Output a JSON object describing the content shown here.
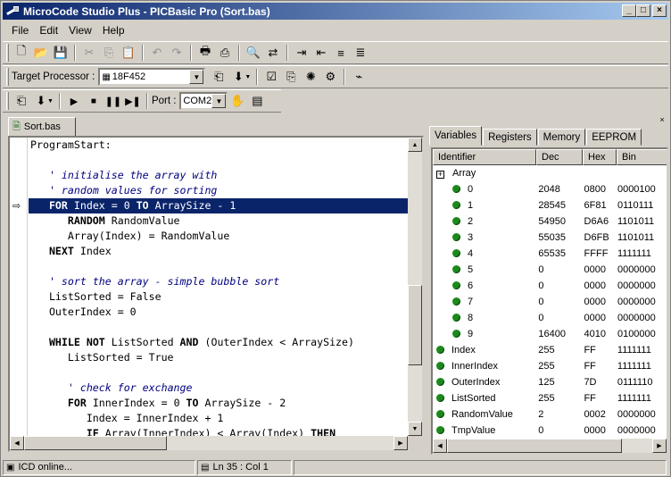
{
  "window": {
    "title": "MicroCode Studio Plus - PICBasic Pro (Sort.bas)"
  },
  "menu": {
    "items": [
      "File",
      "Edit",
      "View",
      "Help"
    ]
  },
  "toolbar2": {
    "target_label": "Target Processor :",
    "processor": "18F452"
  },
  "toolbar3": {
    "port_label": "Port :",
    "port": "COM2"
  },
  "editor": {
    "tab_label": "Sort.bas",
    "lines": [
      {
        "parts": [
          [
            "t",
            "ProgramStart:"
          ]
        ]
      },
      {
        "parts": []
      },
      {
        "parts": [
          [
            "t",
            "   "
          ],
          [
            "c",
            "' initialise the array with"
          ]
        ]
      },
      {
        "parts": [
          [
            "t",
            "   "
          ],
          [
            "c",
            "' random values for sorting"
          ]
        ]
      },
      {
        "hl": true,
        "parts": [
          [
            "t",
            "   "
          ],
          [
            "k",
            "FOR"
          ],
          [
            "t",
            " Index = 0 "
          ],
          [
            "k",
            "TO"
          ],
          [
            "t",
            " ArraySize - 1"
          ]
        ]
      },
      {
        "parts": [
          [
            "t",
            "      "
          ],
          [
            "k",
            "RANDOM"
          ],
          [
            "t",
            " RandomValue"
          ]
        ]
      },
      {
        "parts": [
          [
            "t",
            "      Array(Index) = RandomValue"
          ]
        ]
      },
      {
        "parts": [
          [
            "t",
            "   "
          ],
          [
            "k",
            "NEXT"
          ],
          [
            "t",
            " Index"
          ]
        ]
      },
      {
        "parts": []
      },
      {
        "parts": [
          [
            "t",
            "   "
          ],
          [
            "c",
            "' sort the array - simple bubble sort"
          ]
        ]
      },
      {
        "parts": [
          [
            "t",
            "   ListSorted = False"
          ]
        ]
      },
      {
        "parts": [
          [
            "t",
            "   OuterIndex = 0"
          ]
        ]
      },
      {
        "parts": []
      },
      {
        "parts": [
          [
            "t",
            "   "
          ],
          [
            "k",
            "WHILE NOT"
          ],
          [
            "t",
            " ListSorted "
          ],
          [
            "k",
            "AND"
          ],
          [
            "t",
            " (OuterIndex < ArraySize)"
          ]
        ]
      },
      {
        "parts": [
          [
            "t",
            "      ListSorted = True"
          ]
        ]
      },
      {
        "parts": []
      },
      {
        "parts": [
          [
            "t",
            "      "
          ],
          [
            "c",
            "' check for exchange"
          ]
        ]
      },
      {
        "parts": [
          [
            "t",
            "      "
          ],
          [
            "k",
            "FOR"
          ],
          [
            "t",
            " InnerIndex = 0 "
          ],
          [
            "k",
            "TO"
          ],
          [
            "t",
            " ArraySize - 2"
          ]
        ]
      },
      {
        "parts": [
          [
            "t",
            "         Index = InnerIndex + 1"
          ]
        ]
      },
      {
        "parts": [
          [
            "t",
            "         "
          ],
          [
            "k",
            "IF"
          ],
          [
            "t",
            " Array(InnerIndex) < Array(Index) "
          ],
          [
            "k",
            "THEN"
          ]
        ]
      }
    ]
  },
  "panel": {
    "tabs": [
      "Variables",
      "Registers",
      "Memory",
      "EEPROM"
    ],
    "active_tab": 0,
    "columns": [
      "Identifier",
      "Dec",
      "Hex",
      "Bin"
    ],
    "rows": [
      {
        "kind": "group",
        "name": "Array",
        "dec": "",
        "hex": "",
        "bin": ""
      },
      {
        "kind": "child",
        "name": "0",
        "dec": "2048",
        "hex": "0800",
        "bin": "0000100"
      },
      {
        "kind": "child",
        "name": "1",
        "dec": "28545",
        "hex": "6F81",
        "bin": "0110111"
      },
      {
        "kind": "child",
        "name": "2",
        "dec": "54950",
        "hex": "D6A6",
        "bin": "1101011"
      },
      {
        "kind": "child",
        "name": "3",
        "dec": "55035",
        "hex": "D6FB",
        "bin": "1101011"
      },
      {
        "kind": "child",
        "name": "4",
        "dec": "65535",
        "hex": "FFFF",
        "bin": "1111111"
      },
      {
        "kind": "child",
        "name": "5",
        "dec": "0",
        "hex": "0000",
        "bin": "0000000"
      },
      {
        "kind": "child",
        "name": "6",
        "dec": "0",
        "hex": "0000",
        "bin": "0000000"
      },
      {
        "kind": "child",
        "name": "7",
        "dec": "0",
        "hex": "0000",
        "bin": "0000000"
      },
      {
        "kind": "child",
        "name": "8",
        "dec": "0",
        "hex": "0000",
        "bin": "0000000"
      },
      {
        "kind": "child",
        "name": "9",
        "dec": "16400",
        "hex": "4010",
        "bin": "0100000"
      },
      {
        "kind": "var",
        "name": "Index",
        "dec": "255",
        "hex": "FF",
        "bin": "1111111"
      },
      {
        "kind": "var",
        "name": "InnerIndex",
        "dec": "255",
        "hex": "FF",
        "bin": "1111111"
      },
      {
        "kind": "var",
        "name": "OuterIndex",
        "dec": "125",
        "hex": "7D",
        "bin": "0111110"
      },
      {
        "kind": "var",
        "name": "ListSorted",
        "dec": "255",
        "hex": "FF",
        "bin": "1111111"
      },
      {
        "kind": "var",
        "name": "RandomValue",
        "dec": "2",
        "hex": "0002",
        "bin": "0000000"
      },
      {
        "kind": "var",
        "name": "TmpValue",
        "dec": "0",
        "hex": "0000",
        "bin": "0000000"
      }
    ]
  },
  "status": {
    "icd": "ICD online...",
    "position": "Ln 35 : Col 1"
  },
  "colors": {
    "title_start": "#0a246a",
    "title_end": "#a6caf0",
    "highlight": "#0a246a",
    "dot": "#1b8a1b"
  }
}
